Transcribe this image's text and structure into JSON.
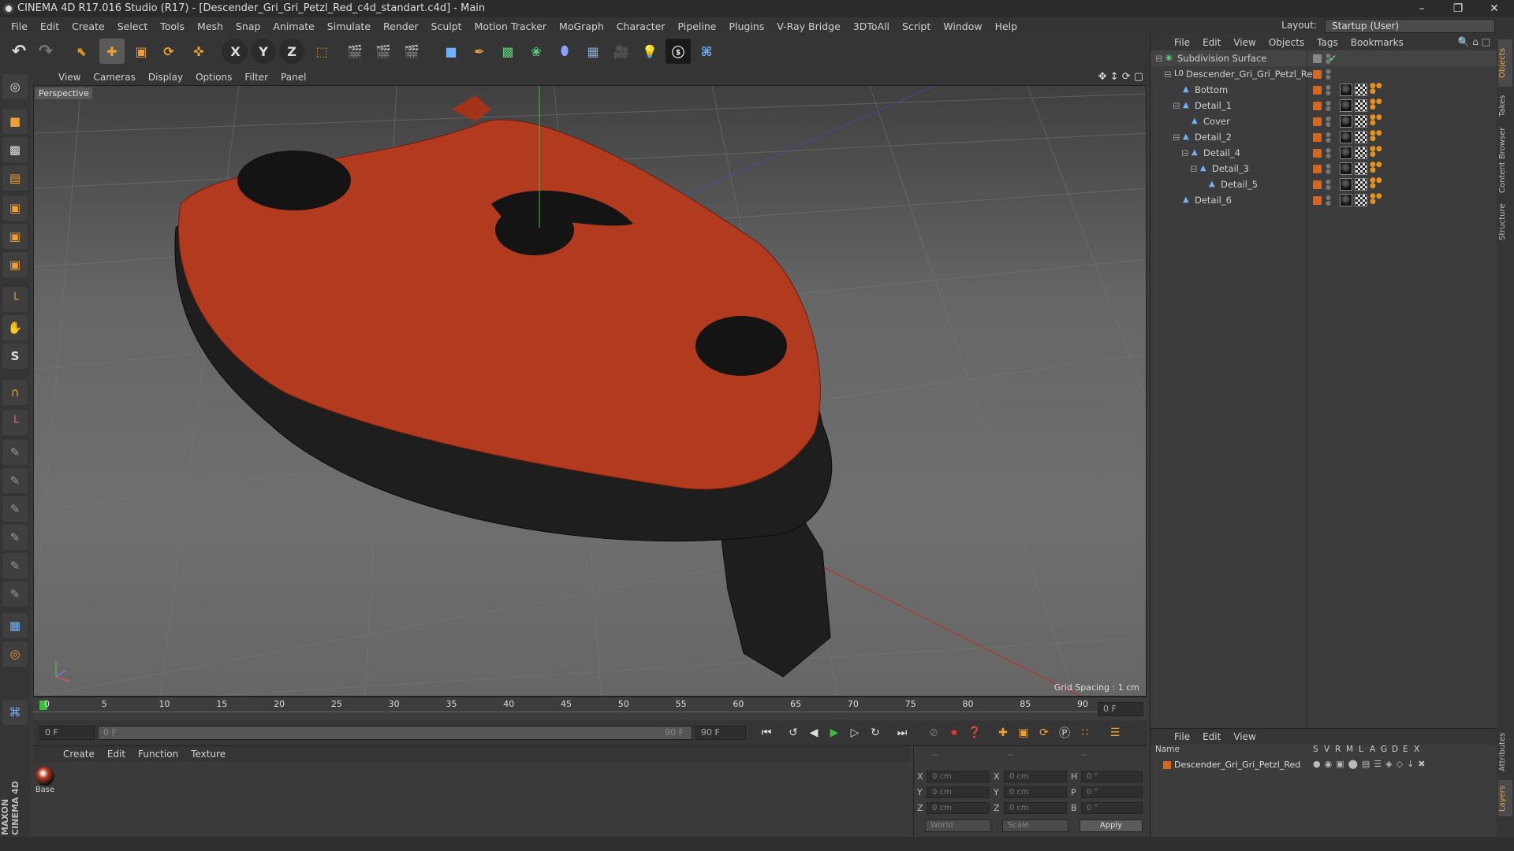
{
  "window": {
    "title": "CINEMA 4D R17.016 Studio (R17) - [Descender_Gri_Gri_Petzl_Red_c4d_standart.c4d] - Main",
    "minimize": "–",
    "restore": "❐",
    "close": "✕"
  },
  "menu": [
    "File",
    "Edit",
    "Create",
    "Select",
    "Tools",
    "Mesh",
    "Snap",
    "Animate",
    "Simulate",
    "Render",
    "Sculpt",
    "Motion Tracker",
    "MoGraph",
    "Character",
    "Pipeline",
    "Plugins",
    "V-Ray Bridge",
    "3DToAll",
    "Script",
    "Window",
    "Help"
  ],
  "layout": {
    "label": "Layout:",
    "value": "Startup (User)"
  },
  "toolbar": {
    "undo": "↶",
    "redo": "↷",
    "axis_x": "X",
    "axis_y": "Y",
    "axis_z": "Z"
  },
  "viewport_menu": [
    "View",
    "Cameras",
    "Display",
    "Options",
    "Filter",
    "Panel"
  ],
  "viewport": {
    "label": "Perspective",
    "grid_spacing": "Grid Spacing : 1 cm",
    "colors": {
      "red": "#b23a1f",
      "black": "#1e1e1e"
    }
  },
  "timeline": {
    "ticks": [
      "0",
      "5",
      "10",
      "15",
      "20",
      "25",
      "30",
      "35",
      "40",
      "45",
      "50",
      "55",
      "60",
      "65",
      "70",
      "75",
      "80",
      "85",
      "90"
    ],
    "current_frame": "0 F"
  },
  "transport": {
    "start_field": "0 F",
    "range_start": "0 F",
    "range_end": "90 F",
    "end_field": "90 F"
  },
  "material_menu": [
    "Create",
    "Edit",
    "Function",
    "Texture"
  ],
  "material": {
    "name": "Base"
  },
  "coords": {
    "header": [
      "--",
      "--",
      "--"
    ],
    "rows": [
      {
        "a": "X",
        "av": "0 cm",
        "b": "X",
        "bv": "0 cm",
        "c": "H",
        "cv": "0 °"
      },
      {
        "a": "Y",
        "av": "0 cm",
        "b": "Y",
        "bv": "0 cm",
        "c": "P",
        "cv": "0 °"
      },
      {
        "a": "Z",
        "av": "0 cm",
        "b": "Z",
        "bv": "0 cm",
        "c": "B",
        "cv": "0 °"
      }
    ],
    "space": "World",
    "mode": "Scale",
    "apply": "Apply"
  },
  "objects_menu": [
    "File",
    "Edit",
    "View",
    "Objects",
    "Tags",
    "Bookmarks"
  ],
  "objects": [
    {
      "name": "Subdivision Surface",
      "indent": 0,
      "expander": "⊟",
      "icon": "◉",
      "type": "subdiv"
    },
    {
      "name": "Descender_Gri_Gri_Petzl_Red",
      "indent": 1,
      "expander": "⊟",
      "icon": "L0",
      "type": "null"
    },
    {
      "name": "Bottom",
      "indent": 2,
      "expander": "",
      "icon": "▲",
      "type": "mesh"
    },
    {
      "name": "Detail_1",
      "indent": 2,
      "expander": "⊟",
      "icon": "▲",
      "type": "mesh"
    },
    {
      "name": "Cover",
      "indent": 3,
      "expander": "",
      "icon": "▲",
      "type": "mesh"
    },
    {
      "name": "Detail_2",
      "indent": 2,
      "expander": "⊟",
      "icon": "▲",
      "type": "mesh"
    },
    {
      "name": "Detail_4",
      "indent": 3,
      "expander": "⊟",
      "icon": "▲",
      "type": "mesh"
    },
    {
      "name": "Detail_3",
      "indent": 4,
      "expander": "⊟",
      "icon": "▲",
      "type": "mesh"
    },
    {
      "name": "Detail_5",
      "indent": 5,
      "expander": "",
      "icon": "▲",
      "type": "mesh"
    },
    {
      "name": "Detail_6",
      "indent": 2,
      "expander": "",
      "icon": "▲",
      "type": "mesh"
    }
  ],
  "layers_menu": [
    "File",
    "Edit",
    "View"
  ],
  "layers": {
    "columns": [
      "Name",
      "S",
      "V",
      "R",
      "M",
      "L",
      "A",
      "G",
      "D",
      "E",
      "X"
    ],
    "row": "Descender_Gri_Gri_Petzl_Red"
  },
  "right_tabs": [
    "Objects",
    "Takes",
    "Content Browser",
    "Structure"
  ],
  "right_tabs_bottom": [
    "Attributes",
    "Layers"
  ],
  "logo": "MAXON CINEMA 4D"
}
